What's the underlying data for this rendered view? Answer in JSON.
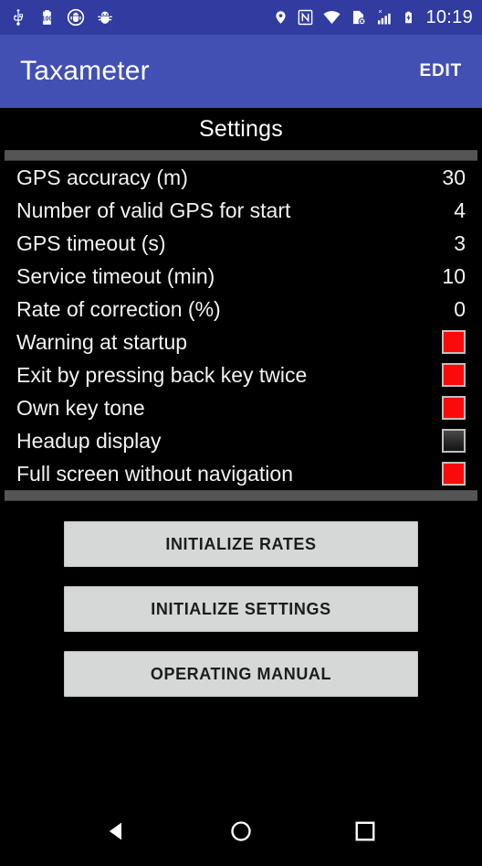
{
  "status_bar": {
    "background_color": "#303CA0",
    "clock": "10:19",
    "left_icons": [
      {
        "name": "usb-icon",
        "label": "USB"
      },
      {
        "name": "battery-100-icon",
        "label": "100"
      },
      {
        "name": "android-debug-icon",
        "label": "ADB"
      },
      {
        "name": "bug-icon",
        "label": "Bug"
      }
    ],
    "right_icons": [
      {
        "name": "location-pin-icon",
        "label": "Location"
      },
      {
        "name": "nfc-icon",
        "label": "NFC"
      },
      {
        "name": "wifi-icon",
        "label": "Wi-Fi"
      },
      {
        "name": "no-sim-icon",
        "label": "No SIM"
      },
      {
        "name": "signal-bars-icon",
        "label": "Signal"
      },
      {
        "name": "battery-charging-icon",
        "label": "Battery charging"
      }
    ]
  },
  "app_bar": {
    "background_color": "#4250B4",
    "title": "Taxameter",
    "action_label": "EDIT"
  },
  "panel": {
    "title": "Settings"
  },
  "settings": {
    "rows": [
      {
        "label": "GPS accuracy (m)",
        "type": "value",
        "value": "30"
      },
      {
        "label": "Number of valid GPS for start",
        "type": "value",
        "value": "4"
      },
      {
        "label": "GPS timeout (s)",
        "type": "value",
        "value": "3"
      },
      {
        "label": "Service timeout (min)",
        "type": "value",
        "value": "10"
      },
      {
        "label": "Rate of correction (%)",
        "type": "value",
        "value": "0"
      },
      {
        "label": "Warning at startup",
        "type": "checkbox",
        "checked": true
      },
      {
        "label": "Exit by pressing back key twice",
        "type": "checkbox",
        "checked": true
      },
      {
        "label": "Own key tone",
        "type": "checkbox",
        "checked": true
      },
      {
        "label": "Headup display",
        "type": "checkbox",
        "checked": false
      },
      {
        "label": "Full screen without navigation",
        "type": "checkbox",
        "checked": true
      }
    ],
    "checkbox_on_color": "#FA0A0A",
    "checkbox_border_color": "#BFBFBF",
    "divider_color": "#555555"
  },
  "buttons": [
    {
      "name": "initialize-rates-button",
      "label": "INITIALIZE RATES"
    },
    {
      "name": "initialize-settings-button",
      "label": "INITIALIZE SETTINGS"
    },
    {
      "name": "operating-manual-button",
      "label": "OPERATING MANUAL"
    }
  ],
  "nav_bar": {
    "back": "Back",
    "home": "Home",
    "recents": "Recent apps"
  }
}
